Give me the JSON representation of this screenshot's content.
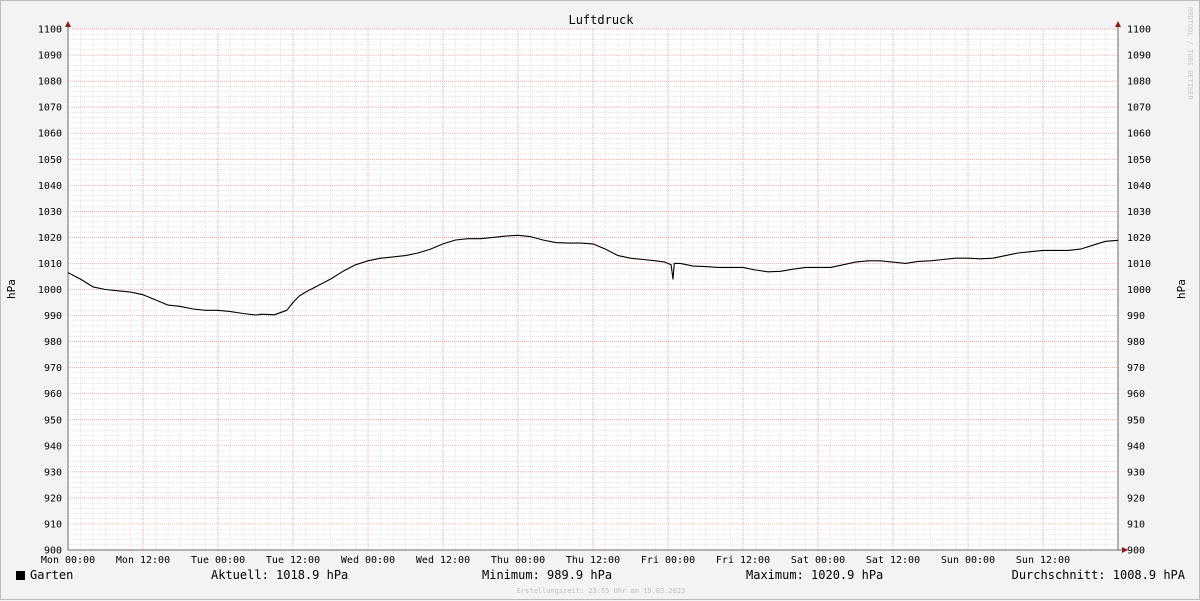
{
  "chart_data": {
    "type": "line",
    "title": "Luftdruck",
    "ylabel": "hPa",
    "ylim": [
      900,
      1100
    ],
    "yticks": [
      900,
      910,
      920,
      930,
      940,
      950,
      960,
      970,
      980,
      990,
      1000,
      1010,
      1020,
      1030,
      1040,
      1050,
      1060,
      1070,
      1080,
      1090,
      1100
    ],
    "xticks": [
      "Mon 00:00",
      "Mon 12:00",
      "Tue 00:00",
      "Tue 12:00",
      "Wed 00:00",
      "Wed 12:00",
      "Thu 00:00",
      "Thu 12:00",
      "Fri 00:00",
      "Fri 12:00",
      "Sat 00:00",
      "Sat 12:00",
      "Sun 00:00",
      "Sun 12:00"
    ],
    "xunit": "hours from Mon 00:00",
    "xlim": [
      0,
      168
    ],
    "grid": true,
    "series": [
      {
        "name": "Garten",
        "color": "#000000",
        "x": [
          0,
          2,
          4,
          6,
          8,
          10,
          12,
          14,
          16,
          18,
          20,
          22,
          24,
          26,
          28,
          30,
          31,
          33,
          35,
          36,
          37,
          38,
          40,
          42,
          44,
          46,
          48,
          50,
          52,
          54,
          56,
          58,
          60,
          62,
          64,
          66,
          68,
          70,
          72,
          74,
          76,
          78,
          80,
          82,
          84,
          86,
          88,
          90,
          92,
          94,
          95.5,
          96.5,
          96.8,
          97,
          98,
          100,
          102,
          104,
          106,
          108,
          110,
          112,
          114,
          116,
          118,
          120,
          122,
          124,
          126,
          128,
          130,
          132,
          134,
          136,
          138,
          140,
          142,
          144,
          146,
          148,
          150,
          152,
          154,
          156,
          158,
          160,
          162,
          164,
          166,
          168
        ],
        "y": [
          1006.5,
          1004,
          1001,
          1000,
          999.5,
          999,
          998,
          996,
          994,
          993.5,
          992.5,
          992,
          992,
          991.5,
          990.8,
          990.2,
          990.5,
          990.3,
          992,
          995,
          997.5,
          999,
          1001.5,
          1004,
          1007,
          1009.5,
          1011,
          1012,
          1012.5,
          1013,
          1014,
          1015.5,
          1017.5,
          1019,
          1019.5,
          1019.5,
          1020,
          1020.5,
          1020.8,
          1020.3,
          1019,
          1018,
          1017.8,
          1017.8,
          1017.5,
          1015.5,
          1013,
          1012,
          1011.5,
          1011,
          1010.5,
          1009.5,
          1004,
          1010,
          1010,
          1009,
          1008.8,
          1008.5,
          1008.5,
          1008.5,
          1007.5,
          1006.8,
          1007,
          1007.8,
          1008.5,
          1008.5,
          1008.5,
          1009.5,
          1010.5,
          1011,
          1011,
          1010.5,
          1010,
          1010.8,
          1011,
          1011.5,
          1012,
          1012,
          1011.8,
          1012,
          1013,
          1014,
          1014.5,
          1015,
          1015,
          1015,
          1015.5,
          1017,
          1018.5,
          1018.9
        ]
      }
    ],
    "stats": {
      "current": "Aktuell: 1018.9 hPa",
      "minimum": "Minimum: 989.9 hPa",
      "maximum": "Maximum: 1020.9 hPa",
      "average": "Durchschnitt: 1008.9 hPA"
    },
    "watermark": "RRDTOOL / TOBI OETIKER",
    "footer": "Erstellungszeit: 23:55 Uhr am 19.03.2023"
  }
}
